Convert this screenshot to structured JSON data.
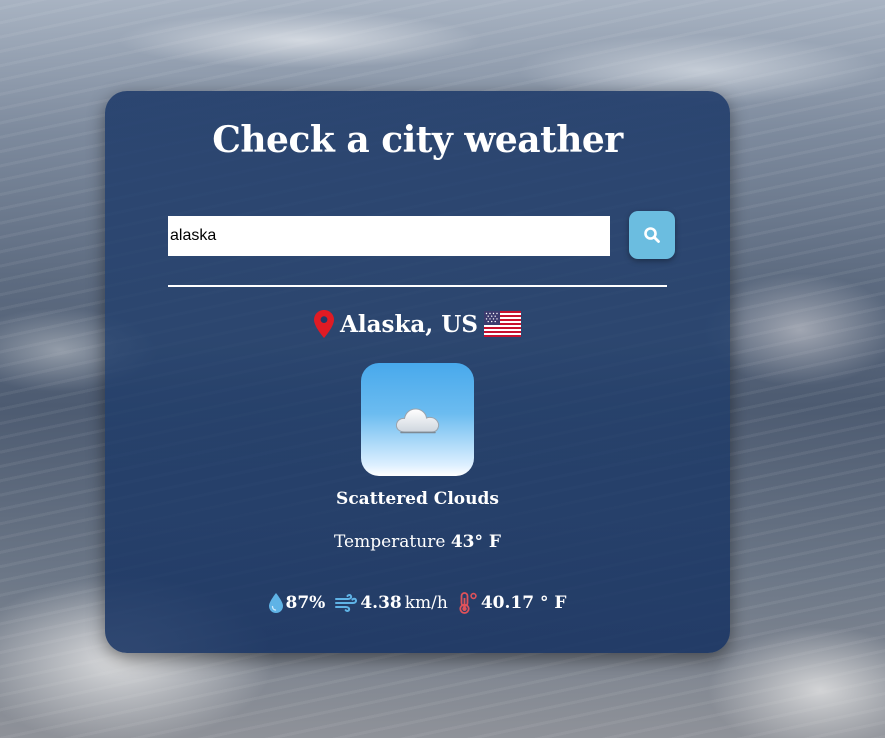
{
  "page": {
    "title": "Check a city weather"
  },
  "search": {
    "value": "alaska",
    "icon": "search-icon"
  },
  "location": {
    "icon": "map-pin-icon",
    "name": "Alaska, US",
    "flag": "us-flag-icon"
  },
  "weather": {
    "icon": "cloud-icon",
    "description": "Scattered Clouds",
    "temperature_label": "Temperature",
    "temperature_value": "43° F"
  },
  "stats": {
    "humidity_icon": "water-drop-icon",
    "humidity": "87%",
    "wind_icon": "wind-icon",
    "wind_value": "4.38",
    "wind_unit": "km/h",
    "feels_icon": "thermometer-icon",
    "feels_like": "40.17 ° F"
  },
  "colors": {
    "card": "#1e3a69",
    "search_button": "#6bbde0",
    "pin": "#e01b24",
    "humidity_icon": "#5fb3e6",
    "wind_icon": "#5fb3e6",
    "thermometer_icon": "#e0525a"
  }
}
